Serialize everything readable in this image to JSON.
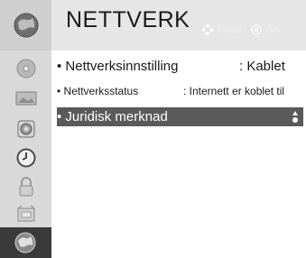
{
  "header": {
    "title": "NETTVERK",
    "move_hint": "Flytte",
    "ok_hint": "OK"
  },
  "sidebar": {
    "icons": [
      "globe-icon",
      "disc-icon",
      "picture-icon",
      "speaker-icon",
      "clock-icon",
      "lock-icon",
      "option-icon",
      "network-icon"
    ],
    "selected_index": 7
  },
  "menu": {
    "items": [
      {
        "label": "• Nettverksinnstilling",
        "value": ": Kablet"
      },
      {
        "label": "• Nettverksstatus",
        "value": ": Internett er koblet til"
      },
      {
        "label": "• Juridisk merknad",
        "value": ""
      }
    ],
    "selected_index": 2
  },
  "colors": {
    "sidebar_bg": "#d9d9d9",
    "header_bg": "#e6e6e6",
    "selected_bg": "#5a5a5a",
    "text": "#1a1a1a"
  }
}
